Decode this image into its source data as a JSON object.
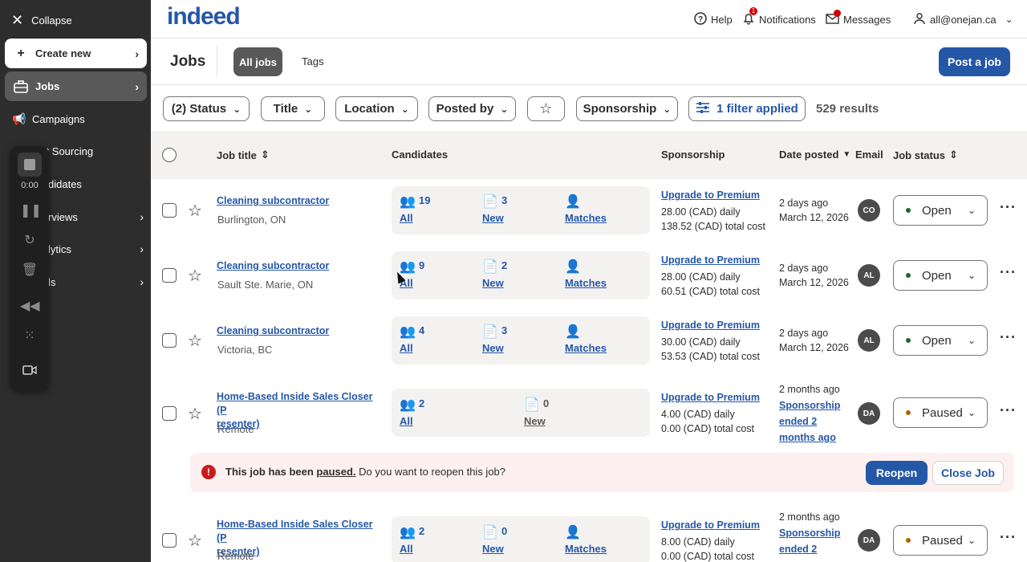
{
  "sidebar": {
    "collapse_label": "Collapse",
    "create_label": "Create new",
    "jobs_label": "Jobs",
    "items": [
      {
        "label": "Campaigns",
        "icon": "megaphone-icon"
      },
      {
        "label": "art Sourcing",
        "icon": "sourcing-icon"
      },
      {
        "label": "didates",
        "icon": "candidates-icon"
      },
      {
        "label": "rviews",
        "icon": "interviews-icon"
      },
      {
        "label": "lytics",
        "icon": "analytics-icon"
      },
      {
        "label": "ls",
        "icon": "tools-icon"
      }
    ]
  },
  "recorder": {
    "time": "0:00"
  },
  "topbar": {
    "logo": "indeed",
    "help_label": "Help",
    "notifications_label": "Notifications",
    "notifications_count": "1",
    "messages_label": "Messages",
    "account_email": "all@onejan.ca"
  },
  "pagehead": {
    "title": "Jobs",
    "tab_all": "All jobs",
    "tab_tags": "Tags",
    "post_job": "Post a job"
  },
  "filters": {
    "status": "(2) Status",
    "title": "Title",
    "location": "Location",
    "posted_by": "Posted by",
    "sponsorship": "Sponsorship",
    "applied": "1 filter applied",
    "results": "529 results"
  },
  "table": {
    "headers": {
      "job_title": "Job title",
      "candidates": "Candidates",
      "sponsorship": "Sponsorship",
      "date_posted": "Date posted",
      "email": "Email",
      "job_status": "Job status"
    },
    "rows": [
      {
        "title": "Cleaning subcontractor",
        "location": "Burlington, ON",
        "all": "19",
        "all_label": "All",
        "new": "3",
        "new_label": "New",
        "matches_label": "Matches",
        "upgrade": "Upgrade to Premium",
        "daily": "28.00 (CAD) daily",
        "total": "138.52 (CAD) total cost",
        "date1": "2 days ago",
        "date2": "March 12, 2026",
        "avatar": "CO",
        "status": "Open"
      },
      {
        "title": "Cleaning subcontractor",
        "location": "Sault Ste. Marie, ON",
        "all": "9",
        "all_label": "All",
        "new": "2",
        "new_label": "New",
        "matches_label": "Matches",
        "upgrade": "Upgrade to Premium",
        "daily": "28.00 (CAD) daily",
        "total": "60.51 (CAD) total cost",
        "date1": "2 days ago",
        "date2": "March 12, 2026",
        "avatar": "AL",
        "status": "Open"
      },
      {
        "title": "Cleaning subcontractor",
        "location": "Victoria, BC",
        "all": "4",
        "all_label": "All",
        "new": "3",
        "new_label": "New",
        "matches_label": "Matches",
        "upgrade": "Upgrade to Premium",
        "daily": "30.00 (CAD) daily",
        "total": "53.53 (CAD) total cost",
        "date1": "2 days ago",
        "date2": "March 12, 2026",
        "avatar": "AL",
        "status": "Open"
      },
      {
        "title_line1": "Home-Based Inside Sales Closer (P",
        "title_line2": "resenter)",
        "location": "Remote",
        "all": "2",
        "all_label": "All",
        "new": "0",
        "new_label": "New",
        "upgrade": "Upgrade to Premium",
        "daily": "4.00 (CAD) daily",
        "total": "0.00 (CAD) total cost",
        "date1": "2 months ago",
        "date_note_1": "Sponsorship",
        "date_note_2": "ended 2",
        "date_note_3": "months ago",
        "avatar": "DA",
        "status": "Paused"
      },
      {
        "title_line1": "Home-Based Inside Sales Closer (P",
        "title_line2": "resenter)",
        "location": "Remote",
        "all": "2",
        "all_label": "All",
        "new": "0",
        "new_label": "New",
        "matches_label": "Matches",
        "upgrade": "Upgrade to Premium",
        "daily": "8.00 (CAD) daily",
        "total": "0.00 (CAD) total cost",
        "date1": "2 months ago",
        "date_note_1": "Sponsorship",
        "date_note_2": "ended 2",
        "avatar": "DA",
        "status": "Paused"
      }
    ]
  },
  "banner": {
    "bold": "This job has been",
    "paused": "paused.",
    "rest": "Do you want to reopen this job?",
    "reopen": "Reopen",
    "close": "Close Job"
  },
  "colors": {
    "brand": "#2557a7",
    "sidebar": "#2d2d2d",
    "open_dot": "#1f662c",
    "paused_dot": "#b25e08",
    "error": "#c91b1b"
  }
}
